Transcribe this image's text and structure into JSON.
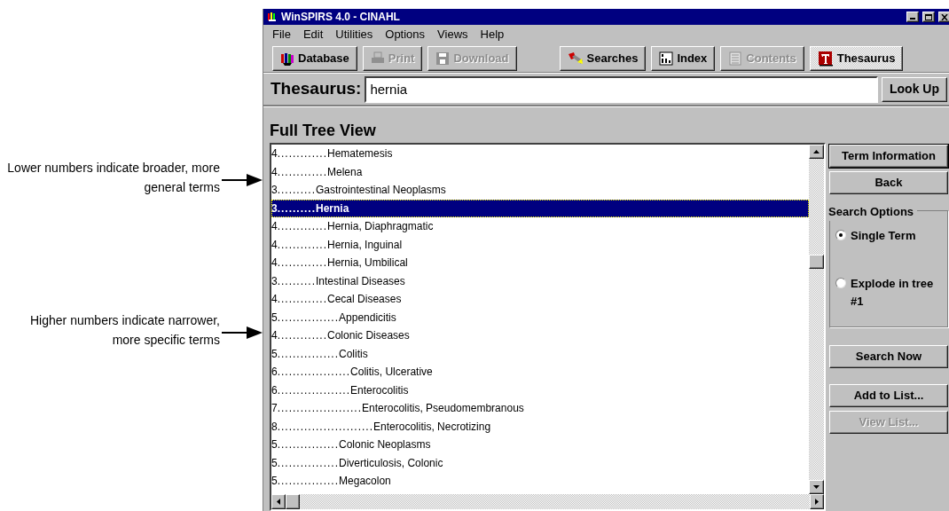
{
  "annotations": [
    {
      "text": "Lower numbers indicate broader, more general terms"
    },
    {
      "text": "Higher numbers indicate narrower, more specific terms"
    }
  ],
  "window": {
    "title": "WinSPIRS 4.0 - CINAHL"
  },
  "menu": [
    {
      "label": "File"
    },
    {
      "label": "Edit"
    },
    {
      "label": "Utilities"
    },
    {
      "label": "Options"
    },
    {
      "label": "Views"
    },
    {
      "label": "Help"
    }
  ],
  "toolbar": [
    {
      "label": "Database",
      "disabled": false,
      "selected": false
    },
    {
      "label": "Print",
      "disabled": true,
      "selected": false
    },
    {
      "label": "Download",
      "disabled": true,
      "selected": false
    },
    {
      "label": "Searches",
      "disabled": false,
      "selected": false
    },
    {
      "label": "Index",
      "disabled": false,
      "selected": false
    },
    {
      "label": "Contents",
      "disabled": true,
      "selected": false
    },
    {
      "label": "Thesaurus",
      "disabled": false,
      "selected": true
    }
  ],
  "search": {
    "label": "Thesaurus:",
    "value": "hernia",
    "button": "Look Up"
  },
  "tree": {
    "title": "Full Tree View",
    "rows": [
      {
        "level": "4",
        "leader": ".............",
        "term": "Hematemesis",
        "selected": false
      },
      {
        "level": "4",
        "leader": ".............",
        "term": "Melena",
        "selected": false
      },
      {
        "level": "3",
        "leader": "..........",
        "term": "Gastrointestinal Neoplasms",
        "selected": false
      },
      {
        "level": "3",
        "leader": "..........",
        "term": "Hernia",
        "selected": true
      },
      {
        "level": "4",
        "leader": ".............",
        "term": "Hernia, Diaphragmatic",
        "selected": false
      },
      {
        "level": "4",
        "leader": ".............",
        "term": "Hernia, Inguinal",
        "selected": false
      },
      {
        "level": "4",
        "leader": ".............",
        "term": "Hernia, Umbilical",
        "selected": false
      },
      {
        "level": "3",
        "leader": "..........",
        "term": "Intestinal Diseases",
        "selected": false
      },
      {
        "level": "4",
        "leader": ".............",
        "term": "Cecal Diseases",
        "selected": false
      },
      {
        "level": "5",
        "leader": "................",
        "term": "Appendicitis",
        "selected": false
      },
      {
        "level": "4",
        "leader": ".............",
        "term": "Colonic Diseases",
        "selected": false
      },
      {
        "level": "5",
        "leader": "................",
        "term": "Colitis",
        "selected": false
      },
      {
        "level": "6",
        "leader": "...................",
        "term": "Colitis, Ulcerative",
        "selected": false
      },
      {
        "level": "6",
        "leader": "...................",
        "term": "Enterocolitis",
        "selected": false
      },
      {
        "level": "7",
        "leader": "......................",
        "term": "Enterocolitis, Pseudomembranous",
        "selected": false
      },
      {
        "level": "8",
        "leader": ".........................",
        "term": "Enterocolitis, Necrotizing",
        "selected": false
      },
      {
        "level": "5",
        "leader": "................",
        "term": "Colonic Neoplasms",
        "selected": false
      },
      {
        "level": "5",
        "leader": "................",
        "term": "Diverticulosis, Colonic",
        "selected": false
      },
      {
        "level": "5",
        "leader": "................",
        "term": "Megacolon",
        "selected": false
      }
    ]
  },
  "side_buttons_top": [
    {
      "label": "Term Information",
      "disabled": false,
      "default": true
    },
    {
      "label": "Back",
      "disabled": false,
      "default": false
    }
  ],
  "search_options": {
    "title": "Search Options",
    "options": [
      {
        "label": "Single Term",
        "selected": true
      },
      {
        "label": "Explode in tree #1",
        "selected": false
      }
    ]
  },
  "side_buttons_bottom": [
    {
      "label": "Search Now",
      "disabled": false,
      "default": false
    },
    {
      "label": "Add to List...",
      "disabled": false,
      "default": false
    },
    {
      "label": "View List...",
      "disabled": true,
      "default": false
    }
  ]
}
